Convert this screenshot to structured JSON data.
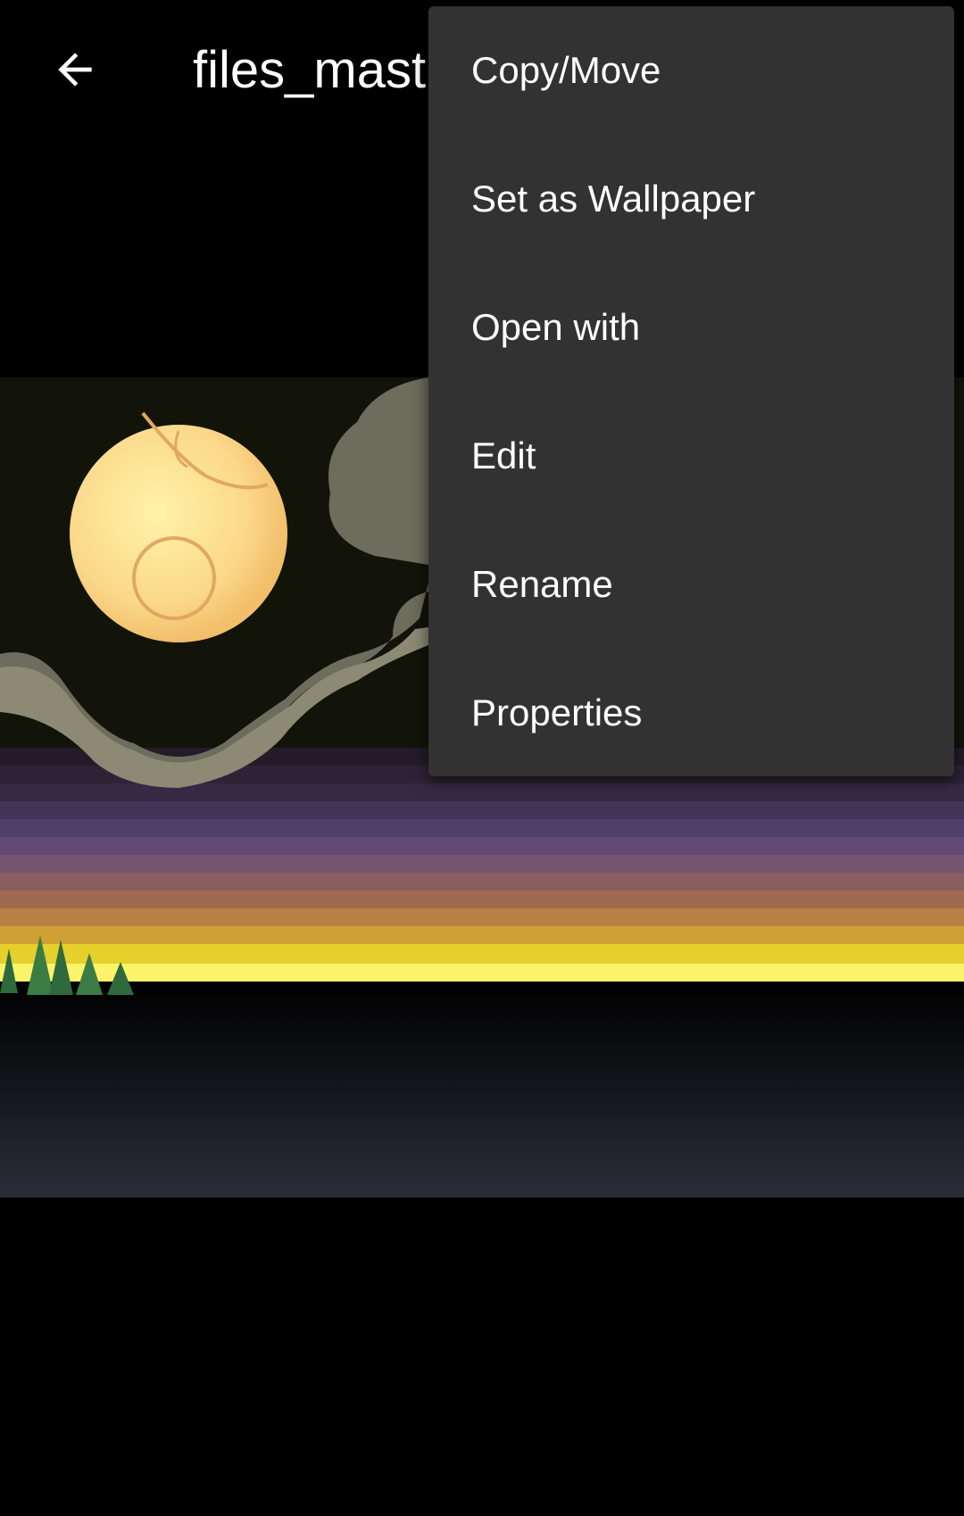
{
  "app_bar": {
    "back_icon": "arrow-left-icon",
    "title": "files_mast"
  },
  "viewer": {
    "image_description_icon": "pixel-art-night-landscape"
  },
  "menu": {
    "items": [
      {
        "label": "Copy/Move"
      },
      {
        "label": "Set as Wallpaper"
      },
      {
        "label": "Open with"
      },
      {
        "label": "Edit"
      },
      {
        "label": "Rename"
      },
      {
        "label": "Properties"
      }
    ]
  },
  "colors": {
    "background": "#000000",
    "menu_background": "#323232",
    "text": "#ffffff"
  }
}
